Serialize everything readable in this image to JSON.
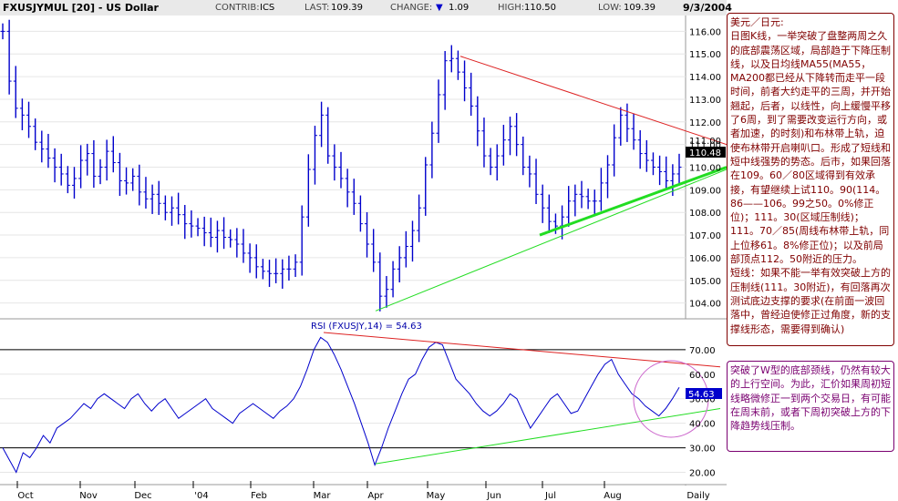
{
  "header": {
    "symbol": "FXUSJYMUL [20] - US Dollar",
    "contrib_label": "CONTRIB:",
    "contrib_value": "ICS",
    "last_label": "LAST:",
    "last_value": "109.39",
    "change_label": "CHANGE:",
    "change_arrow": "▼",
    "change_value": "1.09",
    "high_label": "HIGH:",
    "high_value": "110.50",
    "low_label": "LOW:",
    "low_value": "109.39",
    "date": "9/3/2004"
  },
  "colors": {
    "price_bars": "#0000cc",
    "resistance_line": "#dd2222",
    "support_line": "#22dd22",
    "rsi_line": "#0000cc",
    "annotation_text": "#800000",
    "annotation2_text": "#7a0070",
    "circle": "#cc66cc"
  },
  "chart_data": [
    {
      "type": "ohlc",
      "name": "price",
      "yticks": [
        "104.00",
        "105.00",
        "106.00",
        "107.00",
        "108.00",
        "109.00",
        "110.00",
        "111.00",
        "112.00",
        "113.00",
        "114.00",
        "115.00",
        "116.00"
      ],
      "ylim": [
        103.3,
        116.7
      ],
      "x_labels": [
        "Oct",
        "Nov",
        "Dec",
        "'04",
        "Feb",
        "Mar",
        "Apr",
        "May",
        "Jun",
        "Jul",
        "Aug",
        "Daily"
      ],
      "last_price_label": "110.48",
      "extra_label": "111.00",
      "close": [
        116.0,
        113.8,
        112.6,
        112.3,
        111.8,
        111.1,
        110.8,
        110.4,
        110.0,
        109.7,
        109.2,
        109.5,
        110.3,
        110.6,
        109.6,
        110.0,
        110.7,
        110.2,
        109.4,
        109.3,
        109.6,
        108.9,
        108.6,
        108.8,
        108.4,
        108.0,
        108.2,
        107.9,
        107.5,
        107.4,
        107.3,
        107.1,
        106.9,
        107.2,
        106.9,
        106.8,
        106.6,
        106.2,
        106.0,
        105.6,
        105.4,
        105.3,
        105.3,
        105.5,
        105.5,
        105.8,
        107.8,
        109.9,
        111.4,
        112.3,
        110.5,
        110.0,
        109.5,
        108.9,
        108.4,
        107.5,
        106.6,
        105.8,
        104.3,
        104.6,
        105.5,
        106.0,
        106.5,
        107.2,
        108.2,
        110.1,
        111.5,
        113.2,
        114.7,
        114.8,
        114.2,
        113.5,
        112.7,
        111.6,
        110.5,
        110.0,
        110.5,
        111.2,
        111.8,
        111.0,
        110.0,
        109.7,
        108.8,
        108.2,
        107.6,
        107.4,
        107.8,
        108.5,
        108.8,
        108.7,
        108.5,
        108.5,
        109.3,
        110.1,
        111.3,
        112.3,
        111.7,
        111.2,
        110.6,
        110.3,
        110.0,
        109.8,
        109.4,
        109.7,
        110.0
      ],
      "support_line": {
        "x_label_from": "Apr",
        "y_from": 103.65,
        "y_to": 109.9
      },
      "resistance_line": {
        "x_label_from": "May",
        "y_from": 114.9,
        "y_to": 111.0
      }
    },
    {
      "type": "line",
      "name": "RSI (FXUSJY,14)",
      "title": "RSI (FXUSJY,14) = 54.63",
      "yticks": [
        "20.00",
        "30.00",
        "40.00",
        "50.00",
        "60.00",
        "70.00"
      ],
      "ylim": [
        15,
        77
      ],
      "hlines": [
        70,
        30
      ],
      "last_value_label": "54.63",
      "values": [
        30,
        25,
        20,
        28,
        26,
        30,
        35,
        32,
        38,
        40,
        42,
        45,
        48,
        46,
        50,
        52,
        50,
        48,
        46,
        50,
        52,
        48,
        45,
        48,
        50,
        46,
        42,
        44,
        46,
        48,
        50,
        46,
        44,
        42,
        40,
        44,
        46,
        48,
        46,
        44,
        42,
        45,
        47,
        50,
        55,
        62,
        70,
        75,
        73,
        68,
        62,
        55,
        48,
        40,
        32,
        23,
        30,
        38,
        45,
        52,
        58,
        60,
        66,
        71,
        73,
        72,
        65,
        58,
        55,
        52,
        48,
        45,
        43,
        45,
        48,
        52,
        50,
        44,
        38,
        42,
        46,
        50,
        52,
        48,
        44,
        45,
        50,
        55,
        60,
        64,
        66,
        60,
        56,
        52,
        50,
        47,
        45,
        43,
        46,
        50,
        54.63
      ],
      "support_line": {
        "y_from": 23.5,
        "y_to": 46
      },
      "resistance_line": {
        "y_from": 77,
        "y_to": 63
      }
    }
  ],
  "annotations": {
    "note1": [
      "美元／日元:",
      "日图K线，一举突破了盘整两周之久的底部震荡区域，局部趋于下降压制线，以及日均线MA55(MA55，MA200都已经从下降转而走平一段时间，前者大约走平的三周，并开始翘起，后者，以线性，向上缓慢平移了6周，到了需要改变运行方向，或者加速，的时刻)和布林带上轨，迫使布林带开启喇叭口。形成了短线和短中线强势的势态。后市，如果回落在109。60／80区域得到有效承接，有望继续上试110。90(114。86——106。99之50。0%修正位)；111。30(区域压制线)；111。70／85(周线布林带上轨，同上位移61。8%修正位)；以及前局部顶点112。50附近的压力。",
      "短线：如果不能一举有效突破上方的压制线(111。30附近)，有回落再次测试底边支撑的要求(在前面一波回落中，曾经迫使修正过角度，新的支撑线形态，需要得到确认)"
    ],
    "note2": "突破了W型的底部颈线，仍然有较大的上行空间。为此，汇价如果周初短线略微修正一到两个交易日，有可能在周末前，或者下周初突破上方的下降趋势线压制。"
  }
}
